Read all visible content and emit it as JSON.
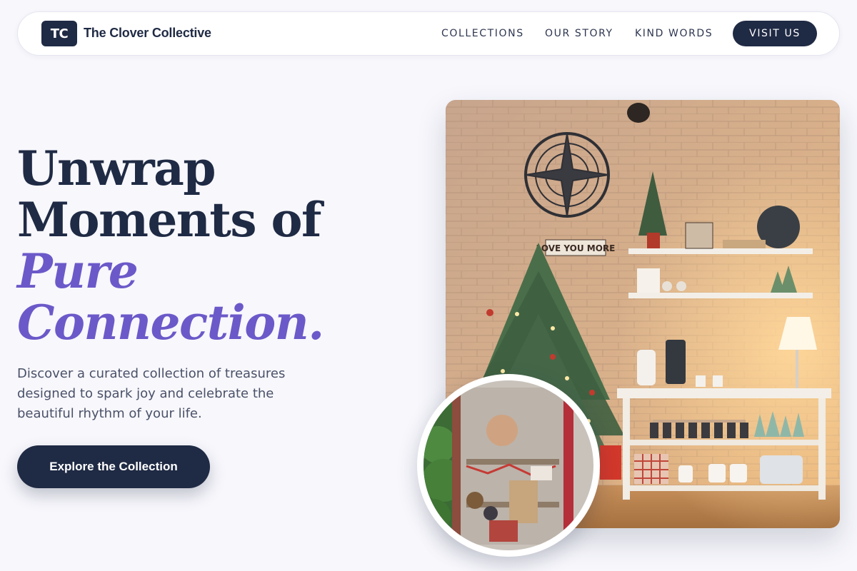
{
  "nav": {
    "logo_initials": "TC",
    "brand": "The Clover Collective",
    "links": [
      {
        "label": "COLLECTIONS"
      },
      {
        "label": "OUR STORY"
      },
      {
        "label": "KIND WORDS"
      }
    ],
    "cta": "VISIT US"
  },
  "hero": {
    "heading_line1": "Unwrap",
    "heading_line2": "Moments of",
    "heading_accent1": "Pure",
    "heading_accent2": "Connection.",
    "description": "Discover a curated collection of treasures designed to spark joy and celebrate the beautiful rhythm of your life.",
    "cta": "Explore the Collection"
  },
  "photo": {
    "sign_text": "LOVE YOU MORE"
  },
  "colors": {
    "primary": "#1f2a44",
    "accent": "#6b59c9",
    "background": "#f7f7fc"
  }
}
